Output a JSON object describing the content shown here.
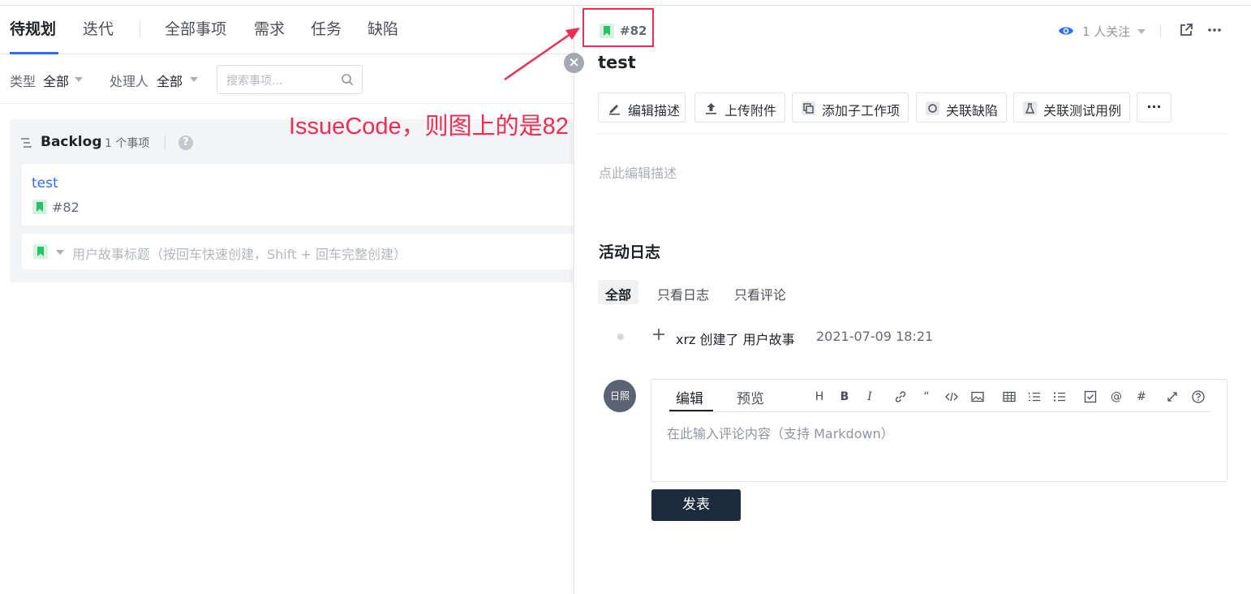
{
  "nav": {
    "tabs": [
      "待规划",
      "迭代",
      "全部事项",
      "需求",
      "任务",
      "缺陷"
    ]
  },
  "filters": {
    "type_label": "类型",
    "type_value": "全部",
    "assignee_label": "处理人",
    "assignee_value": "全部",
    "search_placeholder": "搜索事项..."
  },
  "backlog": {
    "title": "Backlog",
    "count": "1 个事项",
    "help": "?",
    "card_title": "test",
    "card_code": "#82",
    "quick_create_placeholder": "用户故事标题（按回车快速创建，Shift + 回车完整创建）"
  },
  "annotation": {
    "text": "IssueCode，则图上的是82"
  },
  "detail": {
    "code": "#82",
    "watchers": "1 人关注",
    "title": "test",
    "actions": [
      "编辑描述",
      "上传附件",
      "添加子工作项",
      "关联缺陷",
      "关联测试用例"
    ],
    "more": "···",
    "description_placeholder": "点此编辑描述",
    "activity_title": "活动日志",
    "activity_tabs": [
      "全部",
      "只看日志",
      "只看评论"
    ],
    "log_entry": "xrz 创建了 用户故事",
    "log_time": "2021-07-09 18:21",
    "avatar": "日照",
    "editor_tabs": [
      "编辑",
      "预览"
    ],
    "editor_placeholder": "在此输入评论内容（支持 Markdown）",
    "submit": "发表",
    "close": "×"
  },
  "colors": {
    "accent": "#2f6bff",
    "story": "#2cbf6a",
    "annotation": "#ef2d52",
    "submit_bg": "#1d2b3f"
  }
}
